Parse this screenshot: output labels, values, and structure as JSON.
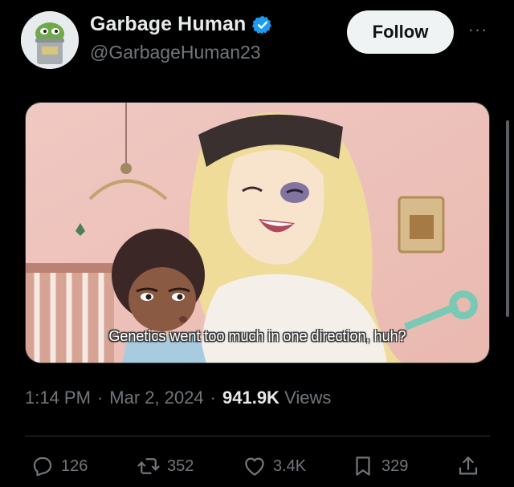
{
  "user": {
    "display_name": "Garbage Human",
    "handle": "@GarbageHuman23",
    "verified": true,
    "avatar_icon": "pepe-trash-can-avatar"
  },
  "follow_label": "Follow",
  "more_label": "···",
  "media": {
    "subtitle": "Genetics went too much in one direction, huh?"
  },
  "meta": {
    "time": "1:14 PM",
    "separator": "·",
    "date": "Mar 2, 2024",
    "views_count": "941.9K",
    "views_label": "Views"
  },
  "actions": {
    "replies": "126",
    "reposts": "352",
    "likes": "3.4K",
    "bookmarks": "329"
  },
  "colors": {
    "background": "#000000",
    "text": "#e7e9ea",
    "muted": "#71767b",
    "verified": "#1d9bf0",
    "follow_bg": "#eff3f4"
  }
}
